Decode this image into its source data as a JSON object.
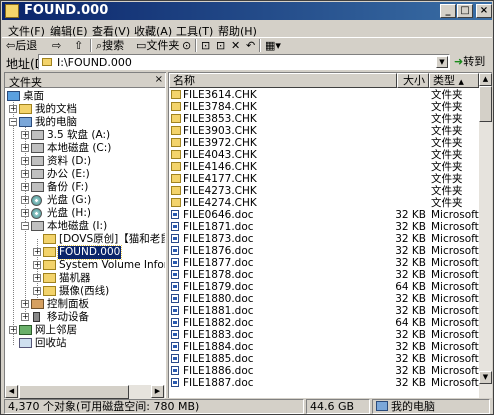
{
  "window": {
    "title": "FOUND.000",
    "controls": {
      "minimize": "_",
      "maximize": "□",
      "close": "×"
    }
  },
  "menu": [
    "文件(F)",
    "编辑(E)",
    "查看(V)",
    "收藏(A)",
    "工具(T)",
    "帮助(H)"
  ],
  "toolbar": {
    "back": "⇦后退",
    "forward": "⇨",
    "up": "⇧",
    "search": "搜索",
    "folders": "文件夹",
    "history": "⊙",
    "move": "⊡",
    "copy": "⊡",
    "delete": "✕",
    "undo": "↶",
    "views": "▦▾"
  },
  "address": {
    "label": "地址(D)",
    "value": "I:\\FOUND.000",
    "go": "转到"
  },
  "tree": {
    "header": "文件夹",
    "close": "×",
    "items": [
      {
        "label": "桌面",
        "icon": "desktop-icon"
      },
      {
        "label": "我的文档",
        "icon": "folder-icon"
      },
      {
        "label": "我的电脑",
        "icon": "computer-icon"
      },
      {
        "label": "3.5 软盘 (A:)",
        "icon": "floppy-icon"
      },
      {
        "label": "本地磁盘 (C:)",
        "icon": "drive-icon"
      },
      {
        "label": "资料 (D:)",
        "icon": "drive-icon"
      },
      {
        "label": "办公 (E:)",
        "icon": "drive-icon"
      },
      {
        "label": "备份 (F:)",
        "icon": "drive-icon"
      },
      {
        "label": "光盘 (G:)",
        "icon": "cd-icon"
      },
      {
        "label": "光盘 (H:)",
        "icon": "cd-icon"
      },
      {
        "label": "本地磁盘 (I:)",
        "icon": "drive-icon"
      },
      {
        "label": "[DOVS原创]【猫和老鼠】",
        "icon": "folder-icon"
      },
      {
        "label": "FOUND.000",
        "icon": "folder-icon"
      },
      {
        "label": "System Volume Informati",
        "icon": "folder-icon"
      },
      {
        "label": "猫机器",
        "icon": "folder-icon"
      },
      {
        "label": "摄像(西线)",
        "icon": "folder-icon"
      },
      {
        "label": "控制面板",
        "icon": "control-panel-icon"
      },
      {
        "label": "移动设备",
        "icon": "mobile-device-icon"
      },
      {
        "label": "网上邻居",
        "icon": "network-icon"
      },
      {
        "label": "回收站",
        "icon": "recycle-bin-icon"
      }
    ]
  },
  "list": {
    "columns": {
      "name": "名称",
      "size": "大小",
      "type": "类型"
    },
    "rows": [
      {
        "name": "FILE3614.CHK",
        "size": "",
        "type": "文件夹",
        "kind": "folder"
      },
      {
        "name": "FILE3784.CHK",
        "size": "",
        "type": "文件夹",
        "kind": "folder"
      },
      {
        "name": "FILE3853.CHK",
        "size": "",
        "type": "文件夹",
        "kind": "folder"
      },
      {
        "name": "FILE3903.CHK",
        "size": "",
        "type": "文件夹",
        "kind": "folder"
      },
      {
        "name": "FILE3972.CHK",
        "size": "",
        "type": "文件夹",
        "kind": "folder"
      },
      {
        "name": "FILE4043.CHK",
        "size": "",
        "type": "文件夹",
        "kind": "folder"
      },
      {
        "name": "FILE4146.CHK",
        "size": "",
        "type": "文件夹",
        "kind": "folder"
      },
      {
        "name": "FILE4177.CHK",
        "size": "",
        "type": "文件夹",
        "kind": "folder"
      },
      {
        "name": "FILE4273.CHK",
        "size": "",
        "type": "文件夹",
        "kind": "folder"
      },
      {
        "name": "FILE4274.CHK",
        "size": "",
        "type": "文件夹",
        "kind": "folder"
      },
      {
        "name": "FILE0646.doc",
        "size": "32 KB",
        "type": "Microsoft W",
        "kind": "doc"
      },
      {
        "name": "FILE1871.doc",
        "size": "32 KB",
        "type": "Microsoft W",
        "kind": "doc"
      },
      {
        "name": "FILE1873.doc",
        "size": "32 KB",
        "type": "Microsoft W",
        "kind": "doc"
      },
      {
        "name": "FILE1876.doc",
        "size": "32 KB",
        "type": "Microsoft W",
        "kind": "doc"
      },
      {
        "name": "FILE1877.doc",
        "size": "32 KB",
        "type": "Microsoft W",
        "kind": "doc"
      },
      {
        "name": "FILE1878.doc",
        "size": "32 KB",
        "type": "Microsoft W",
        "kind": "doc"
      },
      {
        "name": "FILE1879.doc",
        "size": "64 KB",
        "type": "Microsoft W",
        "kind": "doc"
      },
      {
        "name": "FILE1880.doc",
        "size": "32 KB",
        "type": "Microsoft W",
        "kind": "doc"
      },
      {
        "name": "FILE1881.doc",
        "size": "32 KB",
        "type": "Microsoft W",
        "kind": "doc"
      },
      {
        "name": "FILE1882.doc",
        "size": "64 KB",
        "type": "Microsoft W",
        "kind": "doc"
      },
      {
        "name": "FILE1883.doc",
        "size": "32 KB",
        "type": "Microsoft W",
        "kind": "doc"
      },
      {
        "name": "FILE1884.doc",
        "size": "32 KB",
        "type": "Microsoft W",
        "kind": "doc"
      },
      {
        "name": "FILE1885.doc",
        "size": "32 KB",
        "type": "Microsoft W",
        "kind": "doc"
      },
      {
        "name": "FILE1886.doc",
        "size": "32 KB",
        "type": "Microsoft W",
        "kind": "doc"
      },
      {
        "name": "FILE1887.doc",
        "size": "32 KB",
        "type": "Microsoft W",
        "kind": "doc"
      }
    ]
  },
  "status": {
    "objects": "4,370 个对象(可用磁盘空间: 780 MB)",
    "size": "44.6 GB",
    "zone": "我的电脑"
  }
}
